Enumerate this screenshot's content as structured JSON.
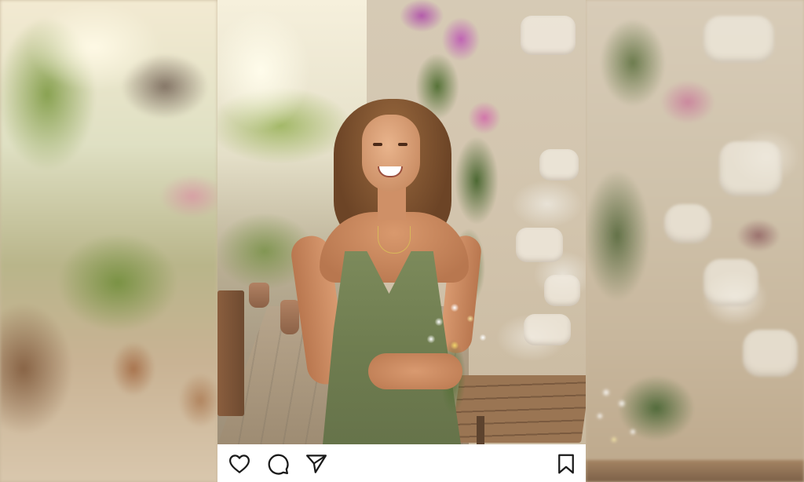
{
  "post": {
    "image_description_icon": "photo",
    "actions": {
      "like_icon": "heart-icon",
      "comment_icon": "comment-icon",
      "share_icon": "send-icon",
      "save_icon": "bookmark-icon"
    }
  },
  "colors": {
    "card_background": "#ffffff",
    "icon_stroke": "#1a1a1a"
  }
}
